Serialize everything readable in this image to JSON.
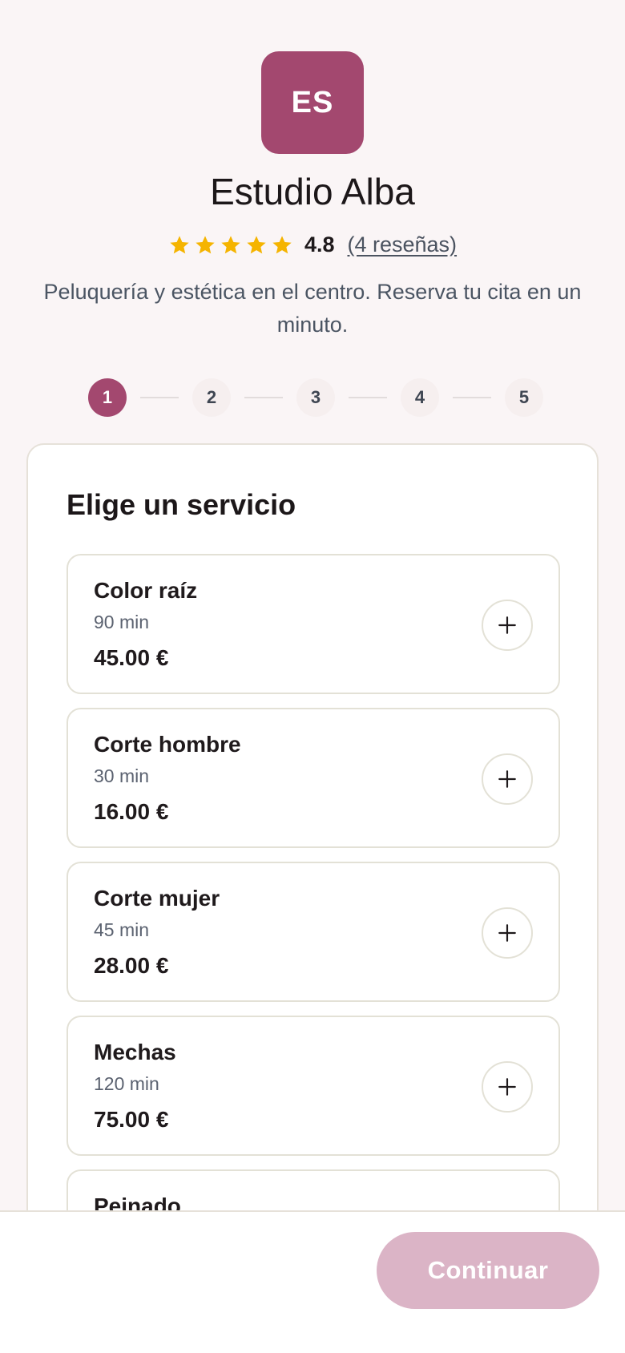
{
  "business": {
    "logo_initials": "ES",
    "name": "Estudio Alba",
    "rating": "4.8",
    "stars_count": 5,
    "reviews_label": "(4 reseñas)",
    "description": "Peluquería y estética en el centro. Reserva tu cita en un minuto."
  },
  "stepper": {
    "steps": [
      "1",
      "2",
      "3",
      "4",
      "5"
    ],
    "active_index": 0
  },
  "services_section": {
    "title": "Elige un servicio",
    "items": [
      {
        "name": "Color raíz",
        "duration": "90 min",
        "price": "45.00 €"
      },
      {
        "name": "Corte hombre",
        "duration": "30 min",
        "price": "16.00 €"
      },
      {
        "name": "Corte mujer",
        "duration": "45 min",
        "price": "28.00 €"
      },
      {
        "name": "Mechas",
        "duration": "120 min",
        "price": "75.00 €"
      },
      {
        "name": "Peinado",
        "duration": "",
        "price": ""
      }
    ]
  },
  "footer": {
    "continue_label": "Continuar"
  },
  "colors": {
    "brand": "#a3486f",
    "brand_disabled": "#dbb4c6",
    "star": "#f5b400",
    "background": "#faf5f6"
  },
  "icons": {
    "star": "star-icon",
    "add": "plus-icon"
  }
}
